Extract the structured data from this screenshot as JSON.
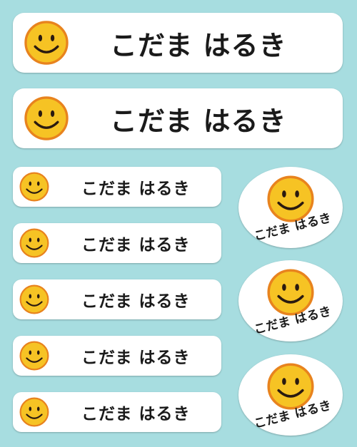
{
  "labels": {
    "name": "こだま はるき"
  },
  "icon": "smiley-face-icon",
  "colors": {
    "background": "#a7dde0",
    "label": "#ffffff",
    "smiley_fill": "#f6c324",
    "smiley_outline": "#e8831e",
    "text": "#1a1a1a"
  }
}
